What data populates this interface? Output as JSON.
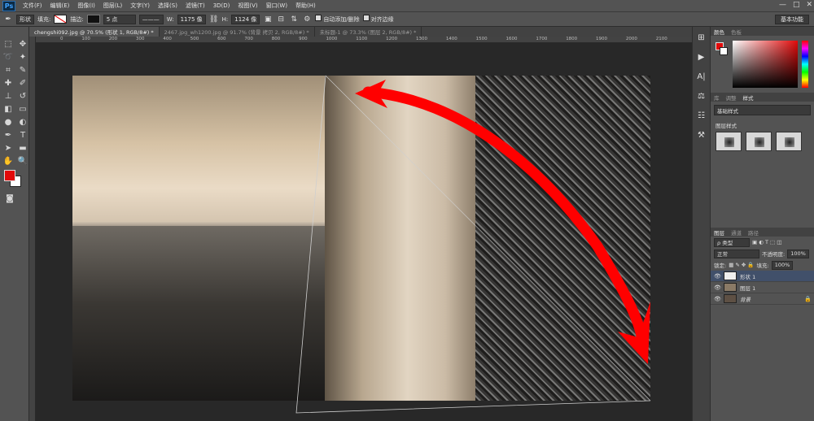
{
  "app": {
    "logo": "Ps",
    "window_controls": [
      "—",
      "□",
      "✕"
    ]
  },
  "menu": [
    "文件(F)",
    "编辑(E)",
    "图像(I)",
    "图层(L)",
    "文字(Y)",
    "选择(S)",
    "滤镜(T)",
    "3D(D)",
    "视图(V)",
    "窗口(W)",
    "帮助(H)"
  ],
  "options": {
    "mode": "形状",
    "fill_label": "填充:",
    "stroke_label": "描边:",
    "stroke_size": "5 点",
    "w_label": "W:",
    "w_value": "1175 像",
    "h_label": "H:",
    "h_value": "1124 像",
    "auto_add_label": "自动添加/删除",
    "align_edges_label": "对齐边缘",
    "workspace": "基本功能"
  },
  "tabs": [
    {
      "label": "chengshi092.jpg @ 70.5% (形状 1, RGB/8#) *",
      "active": true
    },
    {
      "label": "2467.jpg_wh1200.jpg @ 91.7% (背景 拷贝 2, RGB/8#) *",
      "active": false
    },
    {
      "label": "未标题-1 @ 73.3% (图层 2, RGB/8#) *",
      "active": false
    }
  ],
  "ruler_ticks": [
    "0",
    "50",
    "100",
    "150",
    "200",
    "250",
    "300",
    "350",
    "400",
    "450",
    "500",
    "550",
    "600",
    "650",
    "700",
    "750",
    "800",
    "850",
    "900",
    "950",
    "1000",
    "1050",
    "1100",
    "1150",
    "1200",
    "1250",
    "1300",
    "1350",
    "1400",
    "1450",
    "1500",
    "1550",
    "1600",
    "1650",
    "1700",
    "1750",
    "1800",
    "1850",
    "1900",
    "1950",
    "2000",
    "2050",
    "2100"
  ],
  "panels": {
    "color_tabs": [
      "颜色",
      "色板"
    ],
    "adjust_tabs": [
      "库",
      "调整",
      "样式"
    ],
    "style_preset": "基础样式",
    "layer_style_label": "图层样式",
    "layer_tabs": [
      "图层",
      "通道",
      "路径"
    ],
    "kind_filter": "ρ 类型",
    "blend_mode": "正常",
    "opacity_label": "不透明度:",
    "opacity_value": "100%",
    "lock_label": "锁定:",
    "fill_label": "填充:",
    "fill_value": "100%",
    "layers": [
      {
        "name": "形状 1",
        "active": true,
        "locked": false,
        "thumb_color": "#eeeeee"
      },
      {
        "name": "图层 1",
        "active": false,
        "locked": false,
        "thumb_color": "#8a7a66"
      },
      {
        "name": "背景",
        "active": false,
        "locked": true,
        "thumb_color": "#5e5044"
      }
    ]
  },
  "colors": {
    "foreground": "#e20a0a",
    "background": "#ffffff",
    "arrow": "#ff0000"
  }
}
